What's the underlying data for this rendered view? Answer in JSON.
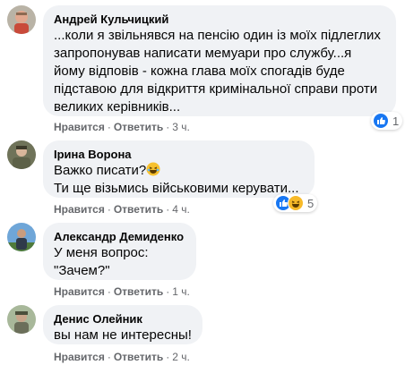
{
  "comments": [
    {
      "author": "Андрей Кульчицкий",
      "text": "...коли я звільнявся на пенсію один із моїх підлеглих\nзапропонував написати мемуари про службу...я\nйому відповів - кожна глава моїх спогадів буде\nпідставою для відкриття кримінальної справи проти\nвеликих керівників...",
      "like": "Нравится",
      "reply": "Ответить",
      "time": "3 ч.",
      "reaction_count": "1"
    },
    {
      "author": "Ірина Ворона",
      "text_line1": "Важко писати?",
      "text_line2": "Ти ще візьмись військовими керувати...",
      "like": "Нравится",
      "reply": "Ответить",
      "time": "4 ч.",
      "reaction_count": "5"
    },
    {
      "author": "Александр Демиденко",
      "text": "У меня вопрос:\n\"Зачем?\"",
      "like": "Нравится",
      "reply": "Ответить",
      "time": "1 ч."
    },
    {
      "author": "Денис Олейник",
      "text": "вы нам не интересны!",
      "like": "Нравится",
      "reply": "Ответить",
      "time": "2 ч."
    }
  ],
  "colors": {
    "bubble": "#f0f2f5",
    "meta": "#65676b",
    "like_reaction": "#1877f2",
    "haha_reaction": "#f7b928"
  }
}
